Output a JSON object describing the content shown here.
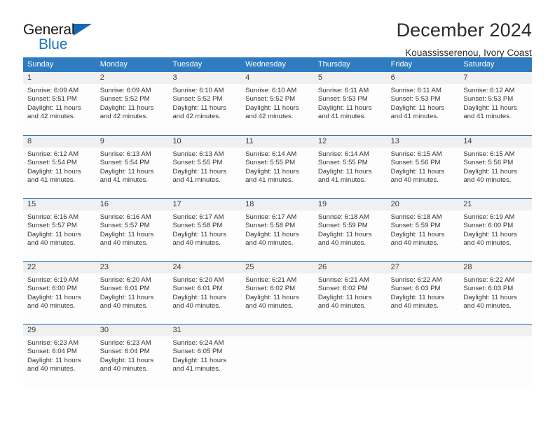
{
  "brand": {
    "name_part1": "General",
    "name_part2": "Blue",
    "triangle_icon": "triangle-icon",
    "accent_color": "#2077c4"
  },
  "header": {
    "title": "December 2024",
    "subtitle": "Kouassisserenou, Ivory Coast"
  },
  "colors": {
    "header_row_bg": "#2f7cc0",
    "week_divider": "#1668b3",
    "daynum_strip_bg": "#f0f0f0",
    "cell_bg": "#fdfdfd",
    "text": "#333333"
  },
  "weekdays": [
    "Sunday",
    "Monday",
    "Tuesday",
    "Wednesday",
    "Thursday",
    "Friday",
    "Saturday"
  ],
  "weeks": [
    [
      {
        "day": "1",
        "sunrise": "Sunrise: 6:09 AM",
        "sunset": "Sunset: 5:51 PM",
        "daylight1": "Daylight: 11 hours",
        "daylight2": "and 42 minutes."
      },
      {
        "day": "2",
        "sunrise": "Sunrise: 6:09 AM",
        "sunset": "Sunset: 5:52 PM",
        "daylight1": "Daylight: 11 hours",
        "daylight2": "and 42 minutes."
      },
      {
        "day": "3",
        "sunrise": "Sunrise: 6:10 AM",
        "sunset": "Sunset: 5:52 PM",
        "daylight1": "Daylight: 11 hours",
        "daylight2": "and 42 minutes."
      },
      {
        "day": "4",
        "sunrise": "Sunrise: 6:10 AM",
        "sunset": "Sunset: 5:52 PM",
        "daylight1": "Daylight: 11 hours",
        "daylight2": "and 42 minutes."
      },
      {
        "day": "5",
        "sunrise": "Sunrise: 6:11 AM",
        "sunset": "Sunset: 5:53 PM",
        "daylight1": "Daylight: 11 hours",
        "daylight2": "and 41 minutes."
      },
      {
        "day": "6",
        "sunrise": "Sunrise: 6:11 AM",
        "sunset": "Sunset: 5:53 PM",
        "daylight1": "Daylight: 11 hours",
        "daylight2": "and 41 minutes."
      },
      {
        "day": "7",
        "sunrise": "Sunrise: 6:12 AM",
        "sunset": "Sunset: 5:53 PM",
        "daylight1": "Daylight: 11 hours",
        "daylight2": "and 41 minutes."
      }
    ],
    [
      {
        "day": "8",
        "sunrise": "Sunrise: 6:12 AM",
        "sunset": "Sunset: 5:54 PM",
        "daylight1": "Daylight: 11 hours",
        "daylight2": "and 41 minutes."
      },
      {
        "day": "9",
        "sunrise": "Sunrise: 6:13 AM",
        "sunset": "Sunset: 5:54 PM",
        "daylight1": "Daylight: 11 hours",
        "daylight2": "and 41 minutes."
      },
      {
        "day": "10",
        "sunrise": "Sunrise: 6:13 AM",
        "sunset": "Sunset: 5:55 PM",
        "daylight1": "Daylight: 11 hours",
        "daylight2": "and 41 minutes."
      },
      {
        "day": "11",
        "sunrise": "Sunrise: 6:14 AM",
        "sunset": "Sunset: 5:55 PM",
        "daylight1": "Daylight: 11 hours",
        "daylight2": "and 41 minutes."
      },
      {
        "day": "12",
        "sunrise": "Sunrise: 6:14 AM",
        "sunset": "Sunset: 5:55 PM",
        "daylight1": "Daylight: 11 hours",
        "daylight2": "and 41 minutes."
      },
      {
        "day": "13",
        "sunrise": "Sunrise: 6:15 AM",
        "sunset": "Sunset: 5:56 PM",
        "daylight1": "Daylight: 11 hours",
        "daylight2": "and 40 minutes."
      },
      {
        "day": "14",
        "sunrise": "Sunrise: 6:15 AM",
        "sunset": "Sunset: 5:56 PM",
        "daylight1": "Daylight: 11 hours",
        "daylight2": "and 40 minutes."
      }
    ],
    [
      {
        "day": "15",
        "sunrise": "Sunrise: 6:16 AM",
        "sunset": "Sunset: 5:57 PM",
        "daylight1": "Daylight: 11 hours",
        "daylight2": "and 40 minutes."
      },
      {
        "day": "16",
        "sunrise": "Sunrise: 6:16 AM",
        "sunset": "Sunset: 5:57 PM",
        "daylight1": "Daylight: 11 hours",
        "daylight2": "and 40 minutes."
      },
      {
        "day": "17",
        "sunrise": "Sunrise: 6:17 AM",
        "sunset": "Sunset: 5:58 PM",
        "daylight1": "Daylight: 11 hours",
        "daylight2": "and 40 minutes."
      },
      {
        "day": "18",
        "sunrise": "Sunrise: 6:17 AM",
        "sunset": "Sunset: 5:58 PM",
        "daylight1": "Daylight: 11 hours",
        "daylight2": "and 40 minutes."
      },
      {
        "day": "19",
        "sunrise": "Sunrise: 6:18 AM",
        "sunset": "Sunset: 5:59 PM",
        "daylight1": "Daylight: 11 hours",
        "daylight2": "and 40 minutes."
      },
      {
        "day": "20",
        "sunrise": "Sunrise: 6:18 AM",
        "sunset": "Sunset: 5:59 PM",
        "daylight1": "Daylight: 11 hours",
        "daylight2": "and 40 minutes."
      },
      {
        "day": "21",
        "sunrise": "Sunrise: 6:19 AM",
        "sunset": "Sunset: 6:00 PM",
        "daylight1": "Daylight: 11 hours",
        "daylight2": "and 40 minutes."
      }
    ],
    [
      {
        "day": "22",
        "sunrise": "Sunrise: 6:19 AM",
        "sunset": "Sunset: 6:00 PM",
        "daylight1": "Daylight: 11 hours",
        "daylight2": "and 40 minutes."
      },
      {
        "day": "23",
        "sunrise": "Sunrise: 6:20 AM",
        "sunset": "Sunset: 6:01 PM",
        "daylight1": "Daylight: 11 hours",
        "daylight2": "and 40 minutes."
      },
      {
        "day": "24",
        "sunrise": "Sunrise: 6:20 AM",
        "sunset": "Sunset: 6:01 PM",
        "daylight1": "Daylight: 11 hours",
        "daylight2": "and 40 minutes."
      },
      {
        "day": "25",
        "sunrise": "Sunrise: 6:21 AM",
        "sunset": "Sunset: 6:02 PM",
        "daylight1": "Daylight: 11 hours",
        "daylight2": "and 40 minutes."
      },
      {
        "day": "26",
        "sunrise": "Sunrise: 6:21 AM",
        "sunset": "Sunset: 6:02 PM",
        "daylight1": "Daylight: 11 hours",
        "daylight2": "and 40 minutes."
      },
      {
        "day": "27",
        "sunrise": "Sunrise: 6:22 AM",
        "sunset": "Sunset: 6:03 PM",
        "daylight1": "Daylight: 11 hours",
        "daylight2": "and 40 minutes."
      },
      {
        "day": "28",
        "sunrise": "Sunrise: 6:22 AM",
        "sunset": "Sunset: 6:03 PM",
        "daylight1": "Daylight: 11 hours",
        "daylight2": "and 40 minutes."
      }
    ],
    [
      {
        "day": "29",
        "sunrise": "Sunrise: 6:23 AM",
        "sunset": "Sunset: 6:04 PM",
        "daylight1": "Daylight: 11 hours",
        "daylight2": "and 40 minutes."
      },
      {
        "day": "30",
        "sunrise": "Sunrise: 6:23 AM",
        "sunset": "Sunset: 6:04 PM",
        "daylight1": "Daylight: 11 hours",
        "daylight2": "and 40 minutes."
      },
      {
        "day": "31",
        "sunrise": "Sunrise: 6:24 AM",
        "sunset": "Sunset: 6:05 PM",
        "daylight1": "Daylight: 11 hours",
        "daylight2": "and 41 minutes."
      },
      {
        "day": "",
        "sunrise": "",
        "sunset": "",
        "daylight1": "",
        "daylight2": ""
      },
      {
        "day": "",
        "sunrise": "",
        "sunset": "",
        "daylight1": "",
        "daylight2": ""
      },
      {
        "day": "",
        "sunrise": "",
        "sunset": "",
        "daylight1": "",
        "daylight2": ""
      },
      {
        "day": "",
        "sunrise": "",
        "sunset": "",
        "daylight1": "",
        "daylight2": ""
      }
    ]
  ]
}
